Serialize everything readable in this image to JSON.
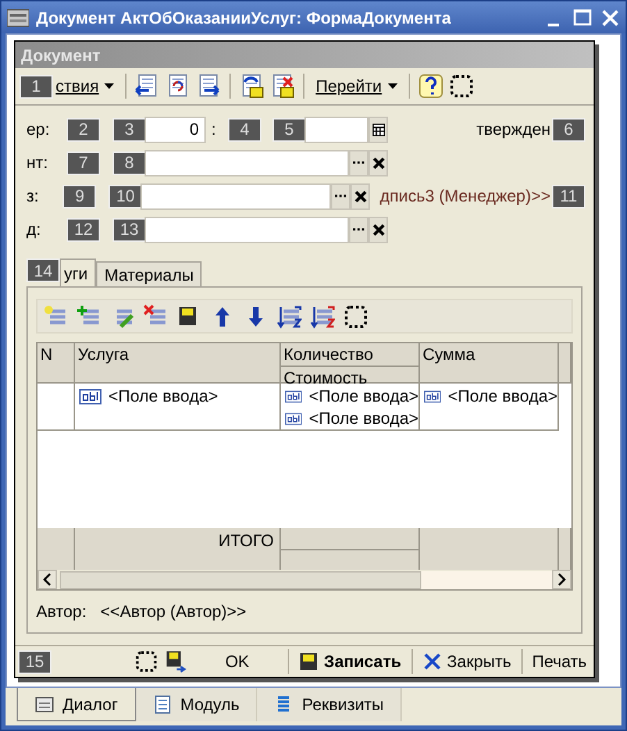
{
  "window": {
    "title": "Документ АктОбОказанииУслуг: ФормаДокумента"
  },
  "form": {
    "title": "Документ"
  },
  "toolbar": {
    "actions_menu": {
      "badge": "1",
      "label": "ствия"
    },
    "goto_menu": {
      "label": "Перейти"
    }
  },
  "header_rows": [
    {
      "label": {
        "badge": "2",
        "text": "ер:"
      },
      "field": {
        "badge": "3",
        "value": "0",
        "kind": "number"
      },
      "extra_label": {
        "badge": "4",
        "text": ":"
      },
      "extra_field": {
        "badge": "5",
        "kind": "date"
      },
      "side": {
        "badge": "6",
        "text": "твержден",
        "kind": "plain"
      }
    },
    {
      "label": {
        "badge": "7",
        "text": "нт:"
      },
      "field": {
        "badge": "8",
        "kind": "reference"
      }
    },
    {
      "label": {
        "badge": "9",
        "text": "з:"
      },
      "field": {
        "badge": "10",
        "kind": "reference"
      },
      "side": {
        "badge": "11",
        "text": "дпись3 (Менеджер)>>",
        "kind": "link"
      }
    },
    {
      "label": {
        "badge": "12",
        "text": "д:"
      },
      "field": {
        "badge": "13",
        "kind": "reference"
      }
    }
  ],
  "tabs": [
    {
      "badge": "14",
      "label": "уги",
      "selected": true
    },
    {
      "label": "Материалы",
      "selected": false
    }
  ],
  "table": {
    "columns": [
      {
        "title": "N"
      },
      {
        "title": "Услуга"
      },
      {
        "title": "Количество",
        "subtitle": "Стоимость"
      },
      {
        "title": "Сумма"
      }
    ],
    "row": [
      [
        "<Поле ввода>"
      ],
      [
        "<Поле ввода>",
        "<Поле ввода>"
      ],
      [
        "<Поле ввода>"
      ]
    ],
    "footer": "ИТОГО"
  },
  "author": {
    "label": "Автор:",
    "value": "<<Автор (Автор)>>"
  },
  "buttons": {
    "badge": "15",
    "ok": "OK",
    "save": "Записать",
    "close": "Закрыть",
    "print": "Печать"
  },
  "bottom_tabs": [
    {
      "label": "Диалог",
      "selected": true
    },
    {
      "label": "Модуль",
      "selected": false
    },
    {
      "label": "Реквизиты",
      "selected": false
    }
  ]
}
